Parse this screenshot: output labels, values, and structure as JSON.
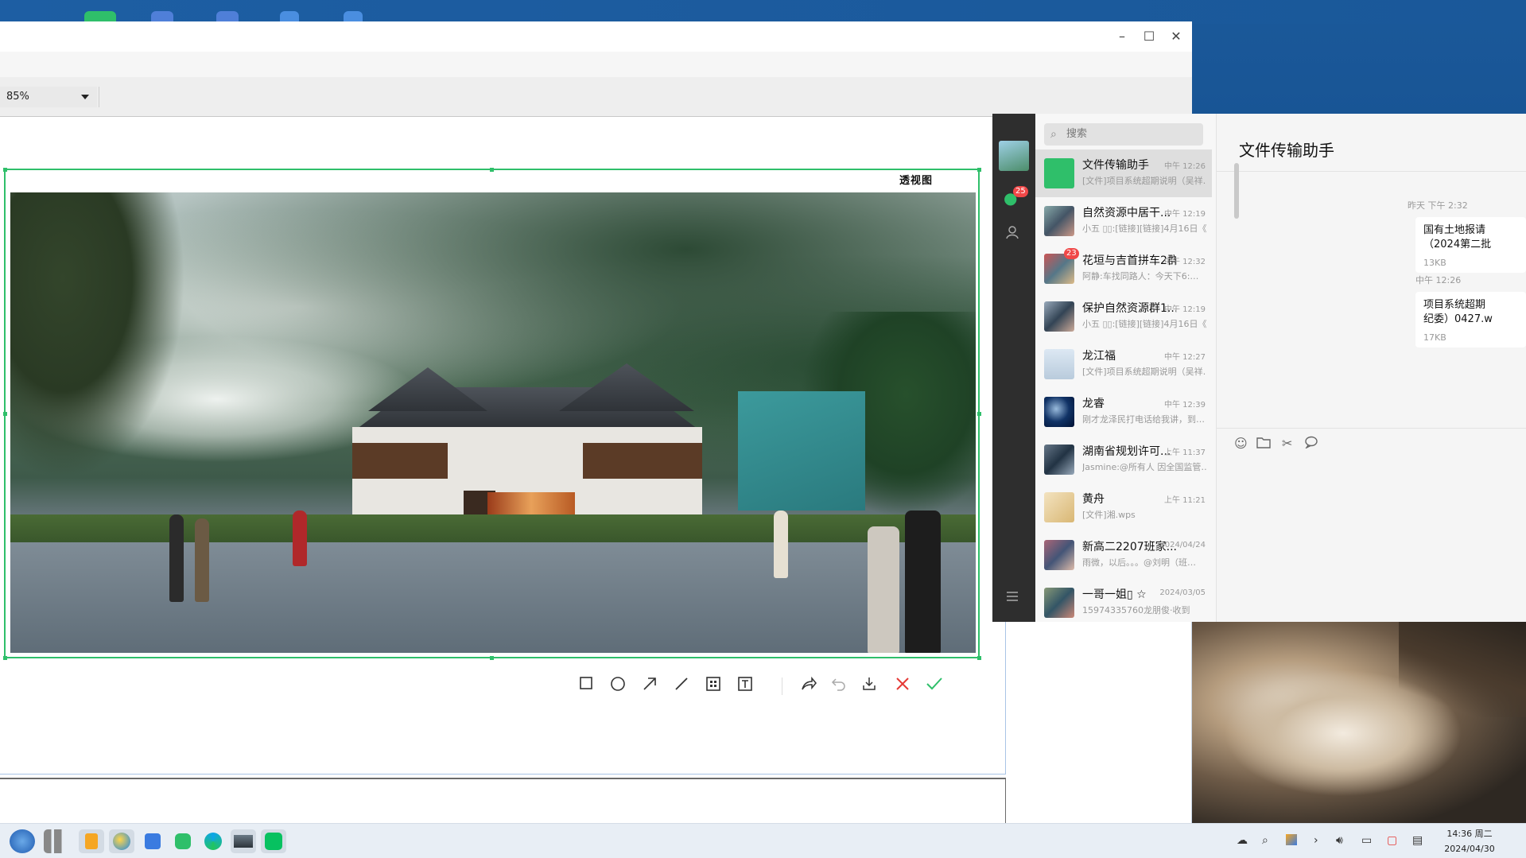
{
  "viewer": {
    "zoom_value": "85%",
    "caption": "透视图",
    "window_controls": {
      "minimize": "–",
      "maximize": "☐",
      "close": "✕"
    }
  },
  "annotation_toolbar": {
    "tools": [
      "rectangle-icon",
      "circle-icon",
      "arrow-icon",
      "line-icon",
      "mosaic-icon",
      "text-icon",
      "share-icon",
      "undo-icon",
      "save-icon",
      "cancel-icon",
      "confirm-icon"
    ]
  },
  "wechat": {
    "badge_count": "25",
    "search_placeholder": "搜索",
    "chats": [
      {
        "name": "文件传输助手",
        "time": "中午 12:26",
        "preview": "[文件]项目系统超期说明（吴祥…"
      },
      {
        "name": "自然资源中居干...",
        "time": "中午 12:19",
        "preview": "小五 ▯▯:[链接][链接]4月16日《…"
      },
      {
        "name": "花垣与吉首拼车2群",
        "time": "中午 12:32",
        "preview": "阿静:车找同路人：今天下6:…",
        "badge": "23"
      },
      {
        "name": "保护自然资源群1...",
        "time": "中午 12:19",
        "preview": "小五 ▯▯:[链接][链接]4月16日《…"
      },
      {
        "name": "龙江福",
        "time": "中午 12:27",
        "preview": "[文件]项目系统超期说明（吴祥…"
      },
      {
        "name": "龙睿",
        "time": "中午 12:39",
        "preview": "刚才龙泽民打电话给我讲，到…"
      },
      {
        "name": "湖南省规划许可...",
        "time": "上午 11:37",
        "preview": "Jasmine:@所有人 因全国监管…"
      },
      {
        "name": "黄舟",
        "time": "上午 11:21",
        "preview": "[文件]湘.wps"
      },
      {
        "name": "新高二2207班家...",
        "time": "2024/04/24",
        "preview": "雨微，以后。。。@刘明（班…"
      },
      {
        "name": "一哥一姐▯ ☆",
        "time": "2024/03/05",
        "preview": "15974335760龙朋俊·收到"
      }
    ],
    "chat_title": "文件传输助手",
    "messages": [
      {
        "time": "昨天 下午 2:32",
        "file_name": "国有土地报请\n（2024第二批",
        "file_size": "13KB"
      },
      {
        "time": "中午 12:26",
        "file_name": "项目系统超期\n纪委）0427.w",
        "file_size": "17KB"
      }
    ]
  },
  "taskbar": {
    "clock_time": "14:36 周二",
    "clock_date": "2024/04/30"
  },
  "colors": {
    "accent_green": "#2fbf6a",
    "wechat_green": "#07c160",
    "cancel_red": "#e53935"
  }
}
